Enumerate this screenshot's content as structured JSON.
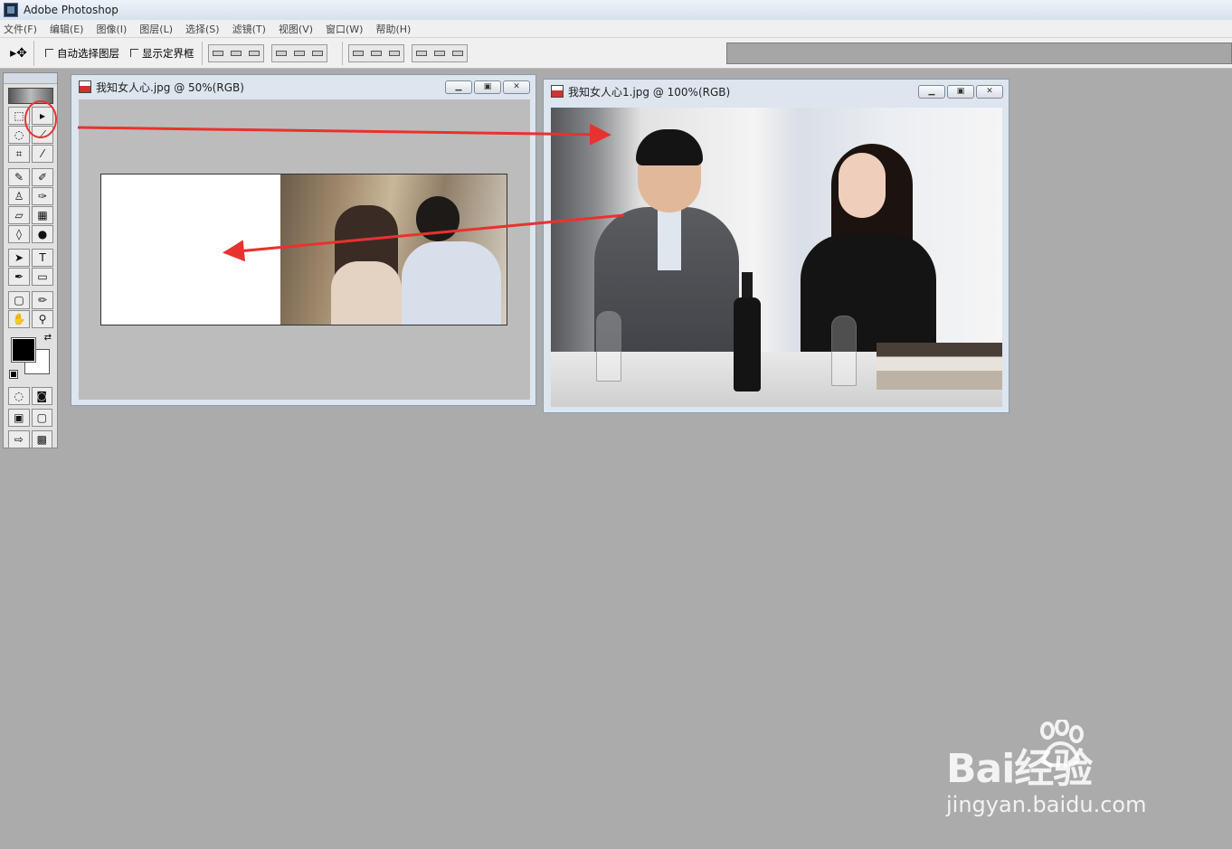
{
  "app": {
    "title": "Adobe Photoshop"
  },
  "menu": [
    "文件(F)",
    "编辑(E)",
    "图像(I)",
    "图层(L)",
    "选择(S)",
    "滤镜(T)",
    "视图(V)",
    "窗口(W)",
    "帮助(H)"
  ],
  "options_bar": {
    "tool_icon": "move-tool-icon",
    "auto_select_layer": {
      "label": "自动选择图层",
      "checked": false
    },
    "show_bounding_box": {
      "label": "显示定界框",
      "checked": false
    }
  },
  "toolbox": {
    "tools": [
      [
        "marquee-icon",
        "move-icon"
      ],
      [
        "lasso-icon",
        "magic-wand-icon"
      ],
      [
        "crop-icon",
        "slice-icon"
      ],
      [
        "healing-brush-icon",
        "brush-icon"
      ],
      [
        "clone-stamp-icon",
        "history-brush-icon"
      ],
      [
        "eraser-icon",
        "gradient-icon"
      ],
      [
        "blur-icon",
        "dodge-icon"
      ],
      [
        "path-selection-icon",
        "type-icon"
      ],
      [
        "pen-icon",
        "rectangle-icon"
      ],
      [
        "notes-icon",
        "eyedropper-icon"
      ],
      [
        "hand-icon",
        "zoom-icon"
      ]
    ],
    "foreground_color": "#000000",
    "background_color": "#ffffff",
    "highlighted_tool": "move-icon"
  },
  "windows": [
    {
      "title": "我知女人心.jpg @ 50%(RGB)"
    },
    {
      "title": "我知女人心1.jpg @ 100%(RGB)"
    }
  ],
  "annotations": {
    "arrow_color": "#e8322f",
    "circle_color": "#e8322f"
  },
  "watermark": {
    "brand": "Bai经验",
    "url": "jingyan.baidu.com"
  }
}
